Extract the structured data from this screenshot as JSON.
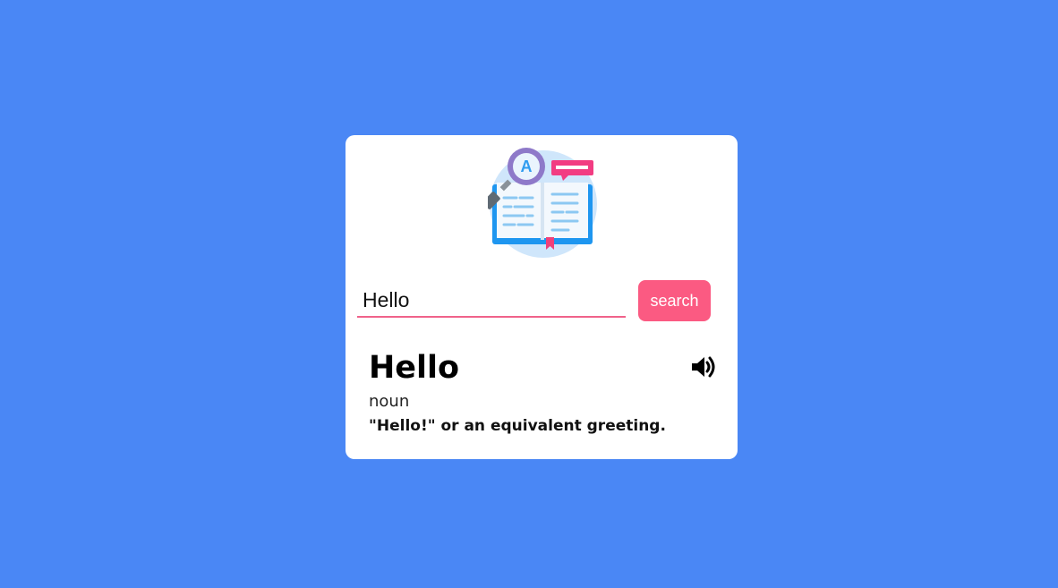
{
  "search": {
    "value": "Hello",
    "button_label": "search"
  },
  "result": {
    "word": "Hello",
    "part_of_speech": "noun",
    "definition": "\"Hello!\" or an equivalent greeting."
  },
  "icons": {
    "logo": "dictionary-book-magnifier-icon",
    "audio": "speaker-volume-icon"
  },
  "colors": {
    "background": "#4a87f5",
    "accent": "#fb5a82",
    "card": "#ffffff"
  }
}
